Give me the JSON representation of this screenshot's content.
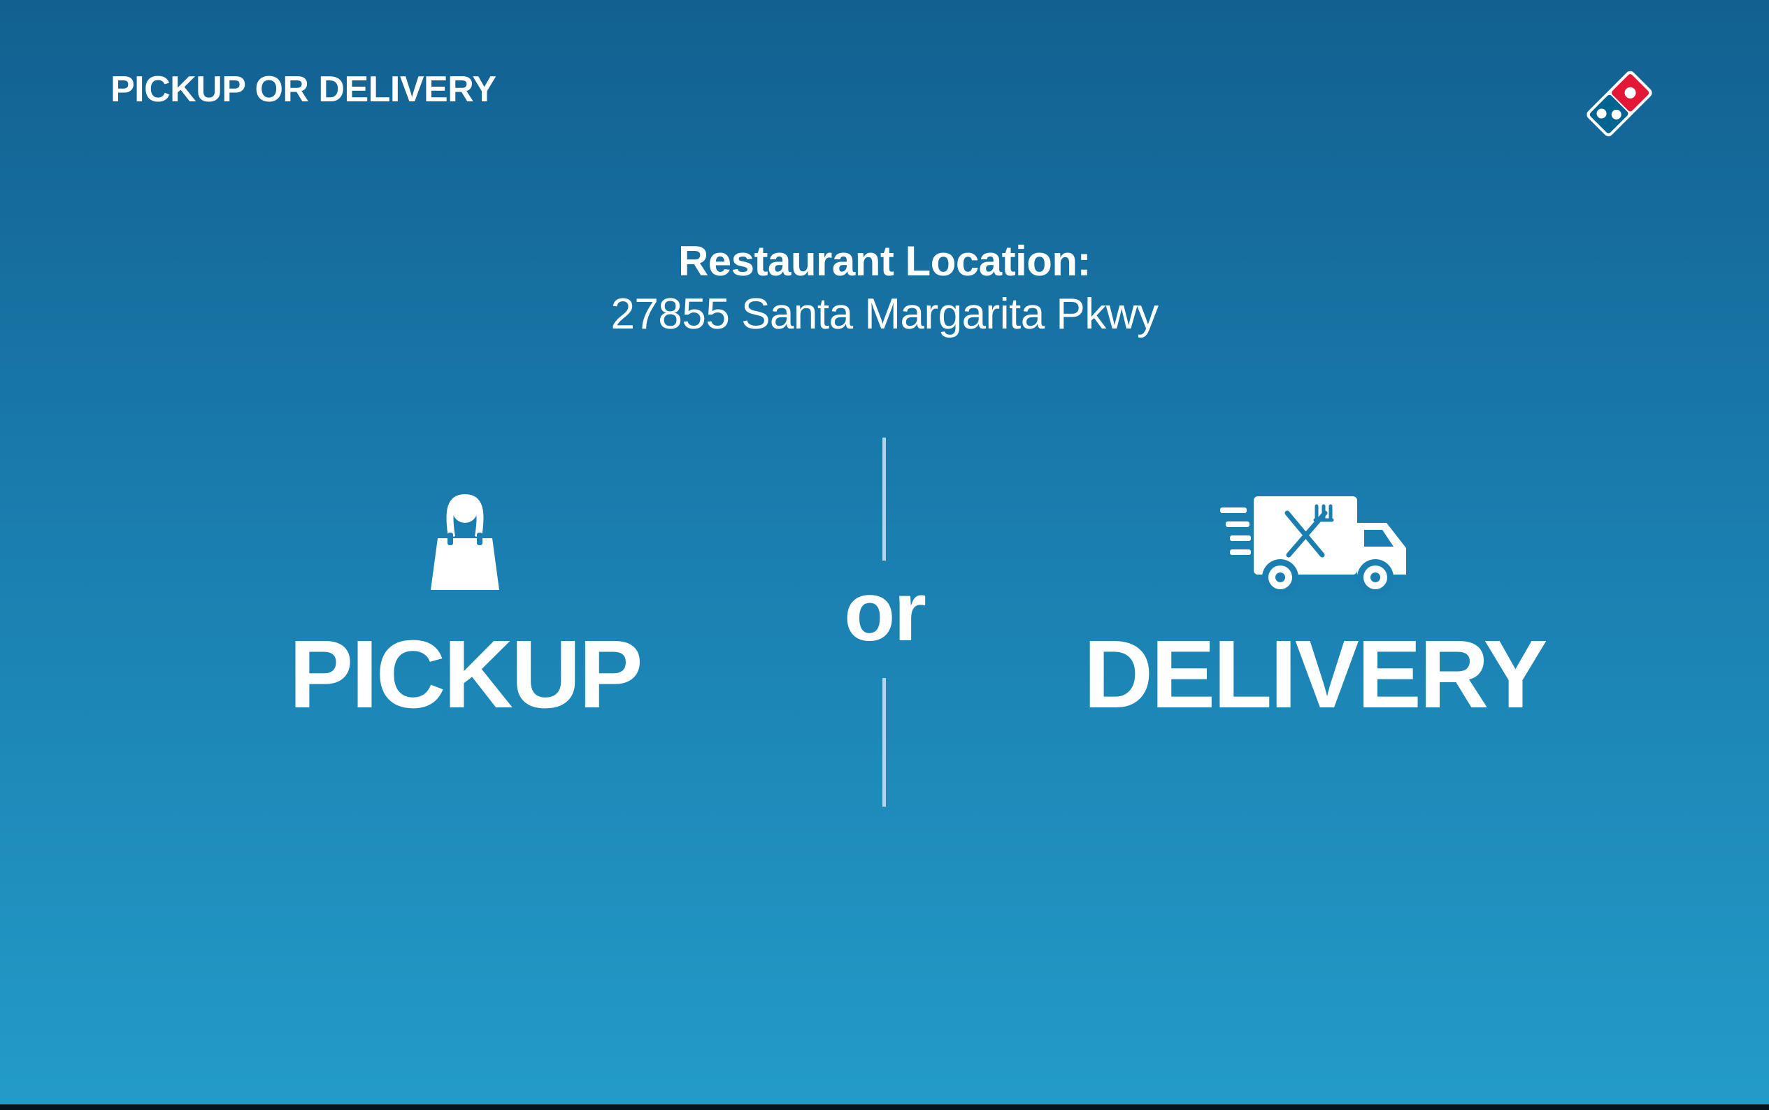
{
  "header": {
    "title": "PICKUP OR DELIVERY",
    "logo_icon": "dominos-domino-logo-icon"
  },
  "location": {
    "label": "Restaurant Location:",
    "address": "27855 Santa Margarita Pkwy"
  },
  "options": {
    "pickup": {
      "label": "PICKUP",
      "icon": "shopping-bag-icon"
    },
    "separator": "or",
    "delivery": {
      "label": "DELIVERY",
      "icon": "delivery-truck-icon"
    }
  },
  "colors": {
    "background_top": "#126090",
    "background_bottom": "#239bc8",
    "text": "#ffffff",
    "logo_red": "#e31837",
    "logo_blue": "#006491"
  }
}
